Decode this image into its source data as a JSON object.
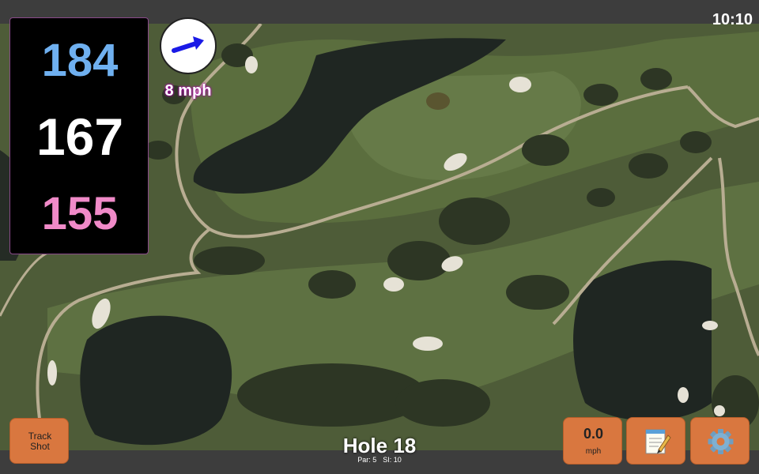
{
  "status": {
    "clock": "10:10"
  },
  "distances": {
    "back": "184",
    "middle": "167",
    "front": "155",
    "back_color": "#6fb0f0",
    "middle_color": "#ffffff",
    "front_color": "#f08ac8"
  },
  "wind": {
    "speed_label": "8 mph",
    "arrow_icon": "arrow-right-icon"
  },
  "buttons": {
    "track_shot": "Track\nShot",
    "speed_value": "0.0",
    "speed_unit": "mph",
    "notes_icon": "notepad-icon",
    "settings_icon": "gear-icon"
  },
  "hole": {
    "title": "Hole 18",
    "par": "Par: 5",
    "si": "SI: 10"
  },
  "colors": {
    "accent_button": "#d9773f",
    "panel_border": "#8a4a8a"
  }
}
